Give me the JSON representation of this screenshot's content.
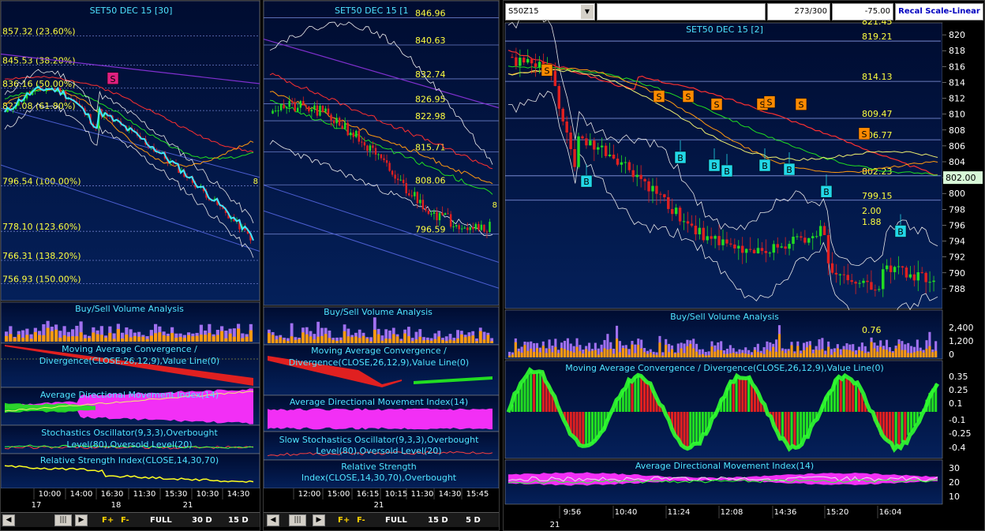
{
  "left_panel": {
    "title": "SET50 DEC 15  [30]",
    "fib_levels": [
      {
        "label": "857.32 (23.60%)",
        "price": 857.32
      },
      {
        "label": "845.53 (38.20%)",
        "price": 845.53
      },
      {
        "label": "836.16 (50.00%)",
        "price": 836.16
      },
      {
        "label": "827.08 (61.80%)",
        "price": 827.08
      },
      {
        "label": "796.54 (100.00%)",
        "price": 796.54
      },
      {
        "label": "778.10 (123.60%)",
        "price": 778.1
      },
      {
        "label": "766.31 (138.20%)",
        "price": 766.31
      },
      {
        "label": "756.93 (150.00%)",
        "price": 756.93
      }
    ],
    "signal_s": "S",
    "subpanels": {
      "volume": "Buy/Sell Volume Analysis",
      "macd": "Moving Average Convergence / Divergence(CLOSE,26,12,9),Value Line(0)",
      "adx": "Average Directional Movement Index(14)",
      "stoch": "Stochastics Oscillator(9,3,3),Overbought Level(80),Oversold Level(20)",
      "rsi": "Relative Strength Index(CLOSE,14,30,70)"
    },
    "time_labels": [
      "10:00",
      "14:00",
      "16:30",
      "11:30",
      "15:30",
      "10:30",
      "14:30"
    ],
    "date_labels": [
      "17",
      "18",
      "21"
    ],
    "buttons": {
      "fplus": "F+",
      "fminus": "F-",
      "full": "FULL",
      "p1": "30 D",
      "p2": "15 D"
    }
  },
  "middle_panel": {
    "title": "SET50 DEC 15  [1",
    "levels": [
      {
        "label": "846.96",
        "price": 846.96
      },
      {
        "label": "840.63",
        "price": 840.63
      },
      {
        "label": "832.74",
        "price": 832.74
      },
      {
        "label": "826.95",
        "price": 826.95
      },
      {
        "label": "822.98",
        "price": 822.98
      },
      {
        "label": "815.71",
        "price": 815.71
      },
      {
        "label": "808.06",
        "price": 808.06
      },
      {
        "label": "796.59",
        "price": 796.59
      }
    ],
    "edge_value": "8",
    "subpanels": {
      "volume": "Buy/Sell Volume Analysis",
      "macd": "Moving Average Convergence / Divergence(CLOSE,26,12,9),Value Line(0)",
      "adx": "Average Directional Movement Index(14)",
      "stoch": "Slow Stochastics Oscillator(9,3,3),Overbought Level(80),Oversold Level(20)",
      "rsi": "Relative Strength Index(CLOSE,14,30,70),Overbought"
    },
    "time_labels": [
      "12:00",
      "15:00",
      "16:15",
      "10:15",
      "11:30",
      "14:30",
      "15:45"
    ],
    "date_labels": [
      "21"
    ],
    "buttons": {
      "fplus": "F+",
      "fminus": "F-",
      "full": "FULL",
      "p1": "15 D",
      "p2": "5 D"
    }
  },
  "right_panel": {
    "toolbar": {
      "symbol": "S50Z15",
      "position": "273/300",
      "change": "-75.00",
      "recal": "Recal Scale-Linear"
    },
    "title": "SET50 DEC 15  [2]",
    "top_partial_label": "821.45",
    "levels": [
      {
        "label": "819.21",
        "price": 819.21
      },
      {
        "label": "814.13",
        "price": 814.13
      },
      {
        "label": "809.47",
        "price": 809.47
      },
      {
        "label": "806.77",
        "price": 806.77
      },
      {
        "label": "802.23",
        "price": 802.23
      },
      {
        "label": "799.15",
        "price": 799.15
      }
    ],
    "extra_labels": [
      "2.00",
      "1.88"
    ],
    "price_axis": [
      "820",
      "818",
      "816",
      "814",
      "812",
      "810",
      "808",
      "806",
      "804",
      "802",
      "800",
      "798",
      "796",
      "794",
      "792",
      "790",
      "788"
    ],
    "last_price": "802.00",
    "signals": {
      "sell": "S",
      "buy": "B"
    },
    "subpanels": {
      "volume": "Buy/Sell Volume Analysis",
      "volume_value": "0.76",
      "volume_axis": [
        "2,400",
        "1,200",
        "0"
      ],
      "macd": "Moving Average Convergence / Divergence(CLOSE,26,12,9),Value Line(0)",
      "macd_axis": [
        "0.35",
        "0.25",
        "0.1",
        "-0.1",
        "-0.25",
        "-0.4"
      ],
      "adx": "Average Directional Movement Index(14)",
      "adx_axis": [
        "30",
        "20",
        "10"
      ]
    },
    "time_labels": [
      "9:56",
      "10:40",
      "11:24",
      "12:08",
      "14:36",
      "15:20",
      "16:04"
    ],
    "date_labels": [
      "21"
    ]
  },
  "colors": {
    "panel_bg_top": "#000c30",
    "panel_bg_bottom": "#04205a",
    "title_cyan": "#4fe3ff",
    "label_yellow": "#ffff40",
    "bull": "#22dd22",
    "bear": "#e02020",
    "sell_marker": "#ff8a00",
    "buy_marker": "#22d8e8",
    "magenta": "#ff30ff"
  }
}
